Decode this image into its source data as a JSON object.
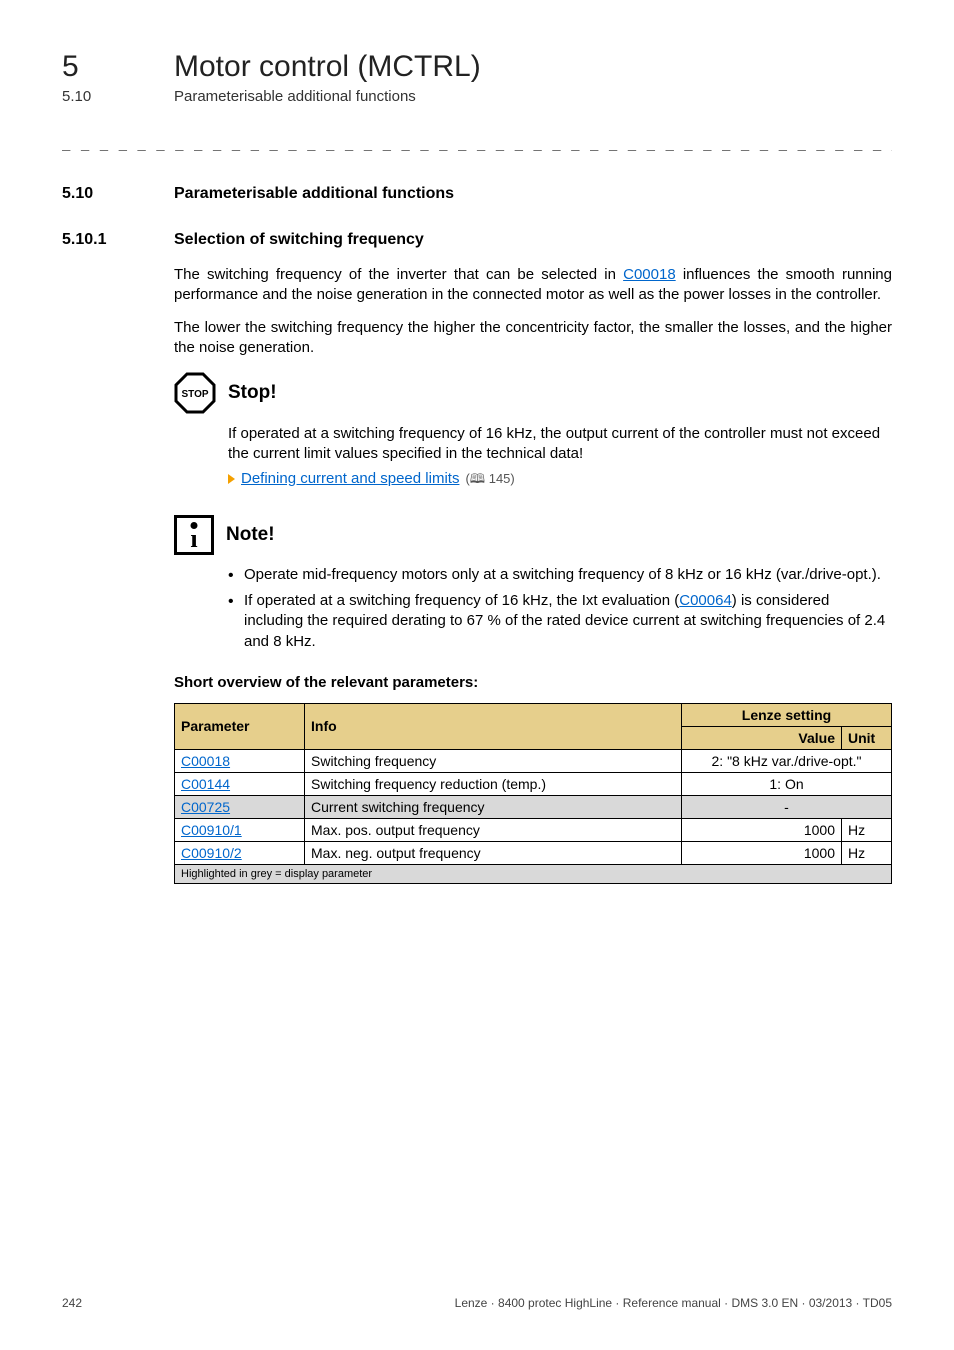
{
  "header": {
    "chapter_num": "5",
    "chapter_title": "Motor control (MCTRL)",
    "section_num": "5.10",
    "section_title": "Parameterisable additional functions"
  },
  "dash_rule": "_ _ _ _ _ _ _ _ _ _ _ _ _ _ _ _ _ _ _ _ _ _ _ _ _ _ _ _ _ _ _ _ _ _ _ _ _ _ _ _ _ _ _ _ _ _ _ _ _ _ _ _ _ _ _ _ _ _ _ _ _ _ _ _",
  "sec": {
    "num": "5.10",
    "title": "Parameterisable additional functions"
  },
  "sub": {
    "num": "5.10.1",
    "title": "Selection of switching frequency"
  },
  "para1_a": "The switching frequency of the inverter that can be selected in ",
  "para1_link": "C00018",
  "para1_b": " influences the smooth running performance and the noise generation in the connected motor as well as the power losses in the controller.",
  "para2": "The lower the switching frequency the higher the concentricity factor, the smaller the losses, and the higher the noise generation.",
  "stop": {
    "label": "STOP",
    "title": "Stop!",
    "body": "If operated at a switching frequency of 16 kHz, the output current of the controller must not exceed the current limit values specified in the technical data!",
    "link_text": "Defining current and speed limits",
    "link_page": "(🕮 145)"
  },
  "note": {
    "title": "Note!",
    "bullet1": "Operate mid-frequency motors only at a switching frequency of 8 kHz or 16 kHz (var./drive-opt.).",
    "bullet2_a": "If operated at a switching frequency of 16 kHz, the Ixt evaluation (",
    "bullet2_link": "C00064",
    "bullet2_b": ") is considered including the required derating to 67 % of the rated device current at switching frequencies of 2.4 and 8 kHz."
  },
  "short_overview": "Short overview of the relevant parameters:",
  "table": {
    "headers": {
      "param": "Parameter",
      "info": "Info",
      "setting": "Lenze setting",
      "value": "Value",
      "unit": "Unit"
    },
    "rows": [
      {
        "param": "C00018",
        "info": "Switching frequency",
        "value": "2: \"8 kHz var./drive-opt.\"",
        "unit": "",
        "grey": false,
        "merged": true
      },
      {
        "param": "C00144",
        "info": "Switching frequency reduction (temp.)",
        "value": "1: On",
        "unit": "",
        "grey": false,
        "merged": true
      },
      {
        "param": "C00725",
        "info": "Current switching frequency",
        "value": "-",
        "unit": "",
        "grey": true,
        "merged": true
      },
      {
        "param": "C00910/1",
        "info": "Max. pos. output frequency",
        "value": "1000",
        "unit": "Hz",
        "grey": false,
        "merged": false
      },
      {
        "param": "C00910/2",
        "info": "Max. neg. output frequency",
        "value": "1000",
        "unit": "Hz",
        "grey": false,
        "merged": false
      }
    ],
    "footnote": "Highlighted in grey = display parameter"
  },
  "footer": {
    "page": "242",
    "meta": "Lenze · 8400 protec HighLine · Reference manual · DMS 3.0 EN · 03/2013 · TD05"
  }
}
